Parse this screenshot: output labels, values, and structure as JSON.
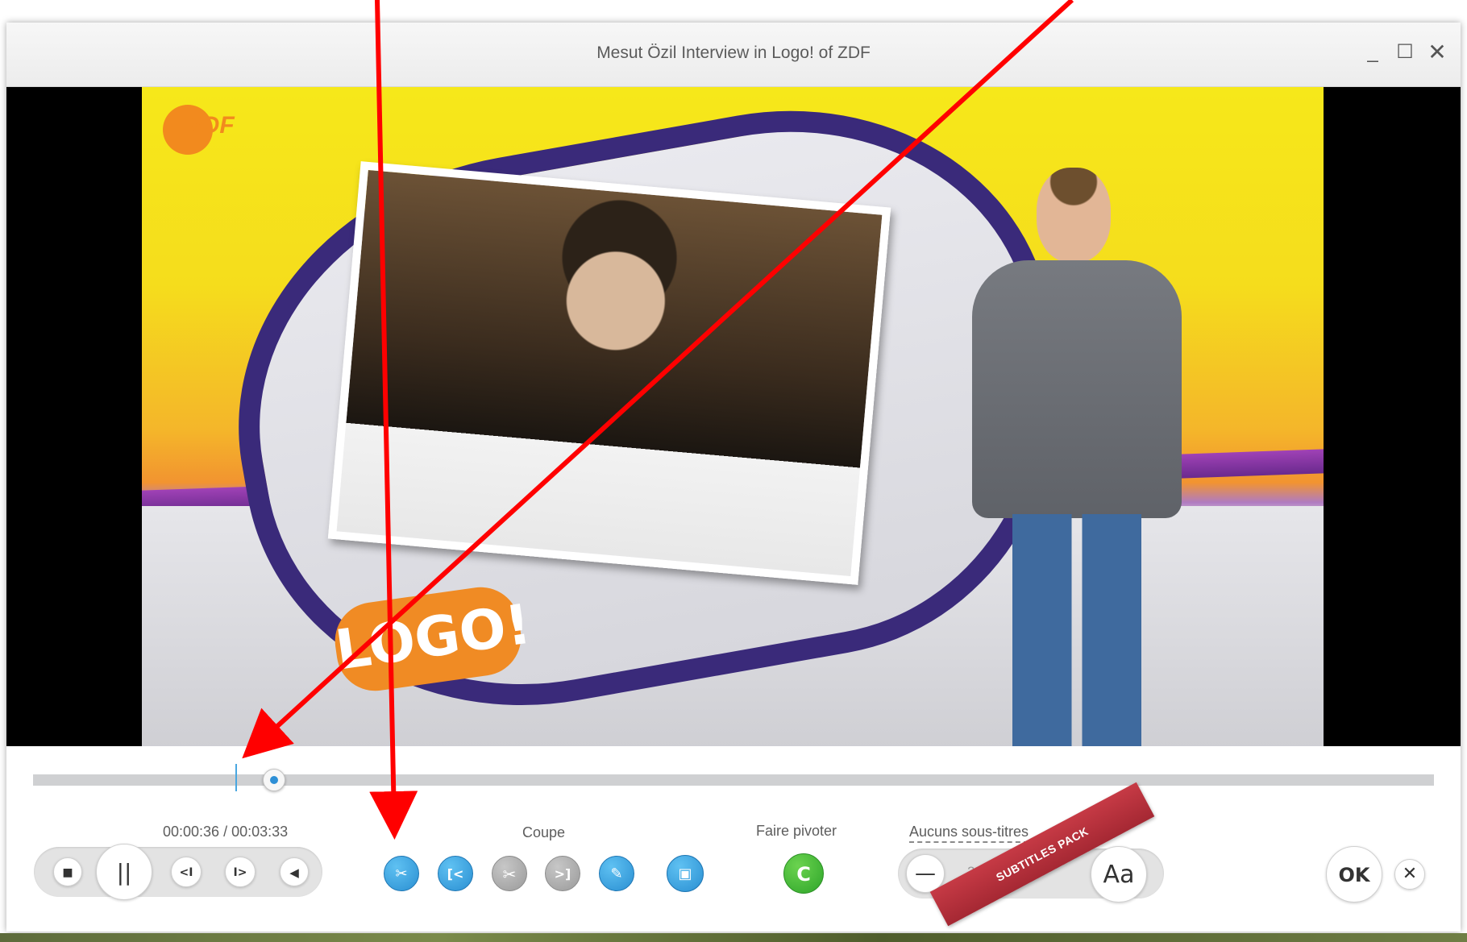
{
  "window": {
    "title": "Mesut Özil Interview in Logo! of ZDF",
    "minimize_glyph": "_",
    "maximize_glyph": "☐",
    "close_glyph": "✕"
  },
  "video": {
    "channel_logo_text": "2DF",
    "show_badge_text": "LOGO!"
  },
  "playback": {
    "time_display": "00:00:36 / 00:03:33",
    "progress": 0.169
  },
  "transport": {
    "stop_glyph": "■",
    "pause_glyph": "||",
    "prev_glyph": "<I",
    "next_glyph": "I>",
    "volume_glyph": "◀"
  },
  "cut": {
    "label": "Coupe",
    "tools": [
      {
        "name": "cut-select-icon",
        "glyph": "✂"
      },
      {
        "name": "cut-start-icon",
        "glyph": "[<"
      },
      {
        "name": "scissors-icon",
        "glyph": "✂"
      },
      {
        "name": "cut-end-icon",
        "glyph": ">]"
      },
      {
        "name": "cut-edit-icon",
        "glyph": "✎"
      }
    ],
    "film_glyph": "▣"
  },
  "rotate": {
    "label": "Faire pivoter",
    "glyph": "C"
  },
  "subtitles": {
    "label": "Aucuns sous-titres",
    "minus_glyph": "—",
    "size_value": "20",
    "ribbon_text": "SUBTITLES PACK",
    "font_button": "Aa"
  },
  "actions": {
    "ok_label": "OK",
    "close_glyph": "✕"
  },
  "colors": {
    "accent_blue": "#2a8fd2",
    "rotate_green": "#2ea52a",
    "ribbon_red": "#c63a45",
    "annotation_arrow": "#ff0000"
  }
}
